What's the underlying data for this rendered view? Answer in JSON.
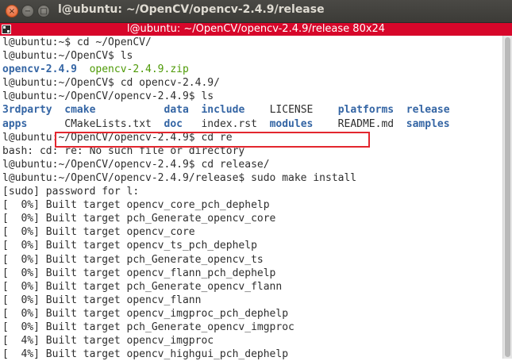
{
  "window": {
    "title": "l@ubuntu: ~/OpenCV/opencv-2.4.9/release",
    "size_banner": "l@ubuntu: ~/OpenCV/opencv-2.4.9/release 80x24",
    "buttons": {
      "close": "×",
      "minimize": "−",
      "maximize": "□"
    }
  },
  "terminal": {
    "lines": [
      [
        {
          "t": "l@ubuntu:~$ cd ~/OpenCV/",
          "c": ""
        }
      ],
      [
        {
          "t": "l@ubuntu:~/OpenCV$ ls",
          "c": ""
        }
      ],
      [
        {
          "t": "opencv-2.4.9",
          "c": "dir"
        },
        {
          "t": "  ",
          "c": ""
        },
        {
          "t": "opencv-2.4.9.zip",
          "c": "zip"
        }
      ],
      [
        {
          "t": "l@ubuntu:~/OpenCV$ cd opencv-2.4.9/",
          "c": ""
        }
      ],
      [
        {
          "t": "l@ubuntu:~/OpenCV/opencv-2.4.9$ ls",
          "c": ""
        }
      ],
      [
        {
          "t": "3rdparty",
          "c": "dir"
        },
        {
          "t": "  ",
          "c": ""
        },
        {
          "t": "cmake",
          "c": "dir"
        },
        {
          "t": "           ",
          "c": ""
        },
        {
          "t": "data",
          "c": "dir"
        },
        {
          "t": "  ",
          "c": ""
        },
        {
          "t": "include",
          "c": "dir"
        },
        {
          "t": "    LICENSE    ",
          "c": ""
        },
        {
          "t": "platforms",
          "c": "dir"
        },
        {
          "t": "  ",
          "c": ""
        },
        {
          "t": "release",
          "c": "dir"
        }
      ],
      [
        {
          "t": "apps",
          "c": "dir"
        },
        {
          "t": "      CMakeLists.txt  ",
          "c": ""
        },
        {
          "t": "doc",
          "c": "dir"
        },
        {
          "t": "   index.rst  ",
          "c": ""
        },
        {
          "t": "modules",
          "c": "dir"
        },
        {
          "t": "    README.md  ",
          "c": ""
        },
        {
          "t": "samples",
          "c": "dir"
        }
      ],
      [
        {
          "t": "l@ubuntu:~/OpenCV/opencv-2.4.9$ cd re",
          "c": ""
        }
      ],
      [
        {
          "t": "bash: cd: re: No such file or directory",
          "c": ""
        }
      ],
      [
        {
          "t": "l@ubuntu:~/OpenCV/opencv-2.4.9$ cd release/",
          "c": ""
        }
      ],
      [
        {
          "t": "l@ubuntu:~/OpenCV/opencv-2.4.9/release$ sudo make install",
          "c": ""
        }
      ],
      [
        {
          "t": "[sudo] password for l:",
          "c": ""
        }
      ],
      [
        {
          "t": "[  0%] Built target opencv_core_pch_dephelp",
          "c": ""
        }
      ],
      [
        {
          "t": "[  0%] Built target pch_Generate_opencv_core",
          "c": ""
        }
      ],
      [
        {
          "t": "[  0%] Built target opencv_core",
          "c": ""
        }
      ],
      [
        {
          "t": "[  0%] Built target opencv_ts_pch_dephelp",
          "c": ""
        }
      ],
      [
        {
          "t": "[  0%] Built target pch_Generate_opencv_ts",
          "c": ""
        }
      ],
      [
        {
          "t": "[  0%] Built target opencv_flann_pch_dephelp",
          "c": ""
        }
      ],
      [
        {
          "t": "[  0%] Built target pch_Generate_opencv_flann",
          "c": ""
        }
      ],
      [
        {
          "t": "[  0%] Built target opencv_flann",
          "c": ""
        }
      ],
      [
        {
          "t": "[  0%] Built target opencv_imgproc_pch_dephelp",
          "c": ""
        }
      ],
      [
        {
          "t": "[  0%] Built target pch_Generate_opencv_imgproc",
          "c": ""
        }
      ],
      [
        {
          "t": "[  4%] Built target opencv_imgproc",
          "c": ""
        }
      ],
      [
        {
          "t": "[  4%] Built target opencv_highgui_pch_dephelp",
          "c": ""
        }
      ]
    ]
  },
  "colors": {
    "titlebar": "#3c3b37",
    "banner": "#d7062a",
    "directory": "#3465a4",
    "archive": "#4e9a06",
    "highlight_box": "#e3262e"
  },
  "icons": [
    "close-icon",
    "minimize-icon",
    "maximize-icon",
    "terminal-icon"
  ]
}
